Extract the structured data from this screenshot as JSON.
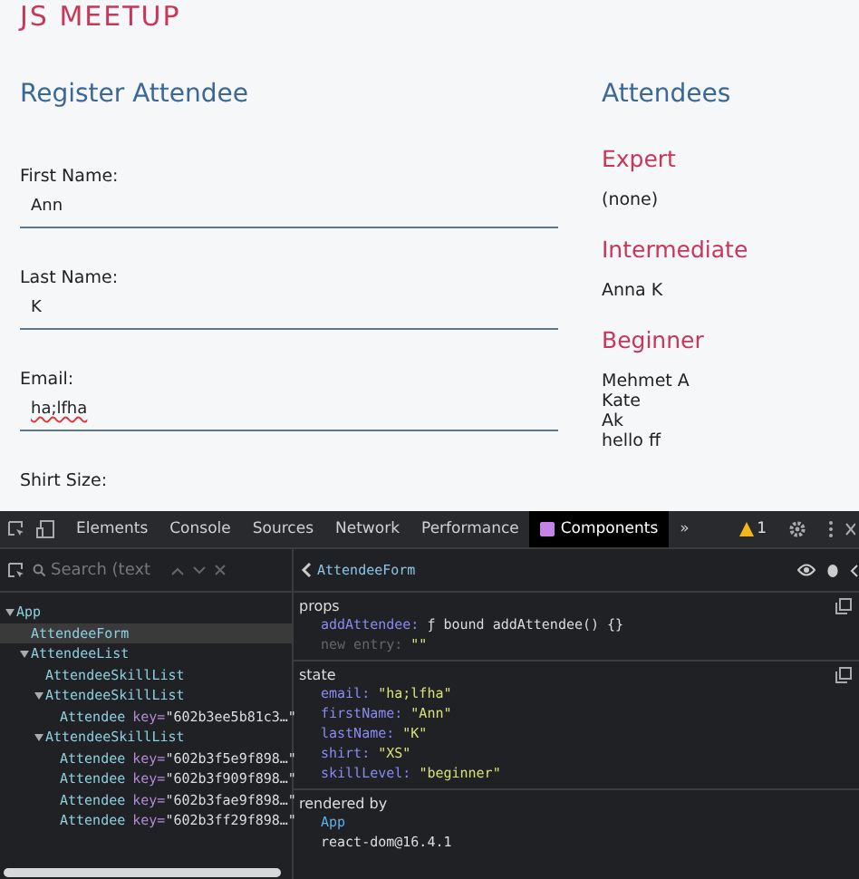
{
  "app": {
    "title": "JS MEETUP",
    "form": {
      "heading": "Register Attendee",
      "fields": [
        {
          "label": "First Name:",
          "value": "Ann",
          "kind": "input",
          "spellcheck_flag": false
        },
        {
          "label": "Last Name:",
          "value": "K",
          "kind": "input",
          "spellcheck_flag": false
        },
        {
          "label": "Email:",
          "value": "ha;lfha",
          "kind": "input",
          "spellcheck_flag": true
        },
        {
          "label": "Shirt Size:",
          "kind": "select"
        }
      ]
    },
    "attendees": {
      "heading": "Attendees",
      "groups": [
        {
          "level": "Expert",
          "names": [
            "(none)"
          ]
        },
        {
          "level": "Intermediate",
          "names": [
            "Anna K"
          ]
        },
        {
          "level": "Beginner",
          "names": [
            "Mehmet A",
            "Kate",
            "Ak",
            "hello ff"
          ]
        }
      ]
    }
  },
  "devtools": {
    "tabs": [
      {
        "label": "Elements",
        "selected": false
      },
      {
        "label": "Console",
        "selected": false
      },
      {
        "label": "Sources",
        "selected": false
      },
      {
        "label": "Network",
        "selected": false
      },
      {
        "label": "Performance",
        "selected": false
      },
      {
        "label": "Components",
        "selected": true
      }
    ],
    "more_tabs": "»",
    "warning_count": "1",
    "search": {
      "placeholder": "Search (text"
    },
    "selected_component": "AttendeeForm",
    "tree": [
      {
        "name": "App",
        "expanded": true,
        "selected": false,
        "children": [
          {
            "name": "AttendeeForm",
            "selected": true
          },
          {
            "name": "AttendeeList",
            "expanded": true,
            "selected": false,
            "children": [
              {
                "name": "AttendeeSkillList",
                "selected": false
              },
              {
                "name": "AttendeeSkillList",
                "expanded": true,
                "selected": false,
                "children": [
                  {
                    "name": "Attendee",
                    "attr": "key=",
                    "value": "\"602b3ee5b81c3…\"",
                    "selected": false
                  }
                ]
              },
              {
                "name": "AttendeeSkillList",
                "expanded": true,
                "selected": false,
                "children": [
                  {
                    "name": "Attendee",
                    "attr": "key=",
                    "value": "\"602b3f5e9f898…\"",
                    "selected": false
                  },
                  {
                    "name": "Attendee",
                    "attr": "key=",
                    "value": "\"602b3f909f898…\"",
                    "selected": false
                  },
                  {
                    "name": "Attendee",
                    "attr": "key=",
                    "value": "\"602b3fae9f898…\"",
                    "selected": false
                  },
                  {
                    "name": "Attendee",
                    "attr": "key=",
                    "value": "\"602b3ff29f898…\"",
                    "selected": false
                  }
                ]
              }
            ]
          }
        ]
      }
    ],
    "sections": [
      {
        "title": "props",
        "rows": [
          {
            "key": "addAttendee:",
            "value": "ƒ bound addAttendee() {}",
            "kind": "function",
            "dimmed": false
          },
          {
            "key": "new entry:",
            "value": "\"\"",
            "kind": "string",
            "dimmed": true
          }
        ]
      },
      {
        "title": "state",
        "rows": [
          {
            "key": "email:",
            "value": "\"ha;lfha\"",
            "kind": "string",
            "dimmed": false
          },
          {
            "key": "firstName:",
            "value": "\"Ann\"",
            "kind": "string",
            "dimmed": false
          },
          {
            "key": "lastName:",
            "value": "\"K\"",
            "kind": "string",
            "dimmed": false
          },
          {
            "key": "shirt:",
            "value": "\"XS\"",
            "kind": "string",
            "dimmed": false
          },
          {
            "key": "skillLevel:",
            "value": "\"beginner\"",
            "kind": "string",
            "dimmed": false
          }
        ]
      }
    ],
    "rendered_by": {
      "title": "rendered by",
      "owners": [
        {
          "name": "App",
          "kind": "component"
        },
        {
          "name": "react-dom@16.4.1",
          "kind": "renderer"
        }
      ]
    }
  }
}
